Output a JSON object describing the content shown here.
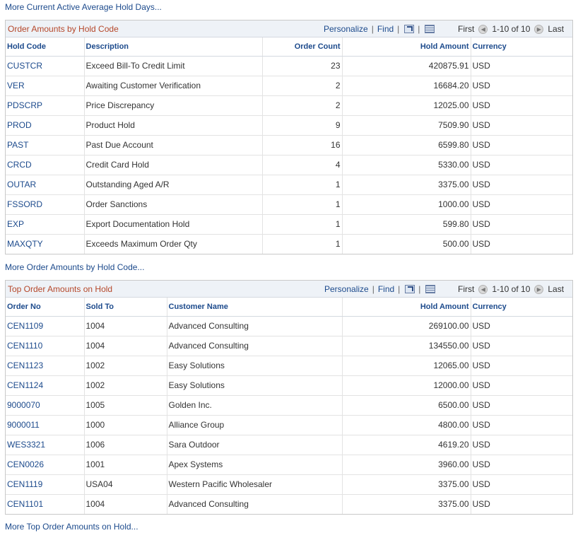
{
  "top_link": "More Current Active Average Hold Days...",
  "grid1": {
    "title": "Order Amounts by Hold Code",
    "personalize": "Personalize",
    "find": "Find",
    "separator": "|",
    "first": "First",
    "range": "1-10 of 10",
    "last": "Last",
    "headers": {
      "hold_code": "Hold Code",
      "description": "Description",
      "order_count": "Order Count",
      "hold_amount": "Hold Amount",
      "currency": "Currency"
    },
    "rows": [
      {
        "code": "CUSTCR",
        "description": "Exceed Bill-To Credit Limit",
        "count": "23",
        "amount": "420875.91",
        "currency": "USD"
      },
      {
        "code": "VER",
        "description": "Awaiting Customer Verification",
        "count": "2",
        "amount": "16684.20",
        "currency": "USD"
      },
      {
        "code": "PDSCRP",
        "description": "Price Discrepancy",
        "count": "2",
        "amount": "12025.00",
        "currency": "USD"
      },
      {
        "code": "PROD",
        "description": "Product Hold",
        "count": "9",
        "amount": "7509.90",
        "currency": "USD"
      },
      {
        "code": "PAST",
        "description": "Past Due Account",
        "count": "16",
        "amount": "6599.80",
        "currency": "USD"
      },
      {
        "code": "CRCD",
        "description": "Credit Card Hold",
        "count": "4",
        "amount": "5330.00",
        "currency": "USD"
      },
      {
        "code": "OUTAR",
        "description": "Outstanding Aged A/R",
        "count": "1",
        "amount": "3375.00",
        "currency": "USD"
      },
      {
        "code": "FSSORD",
        "description": "Order Sanctions",
        "count": "1",
        "amount": "1000.00",
        "currency": "USD"
      },
      {
        "code": "EXP",
        "description": "Export Documentation Hold",
        "count": "1",
        "amount": "599.80",
        "currency": "USD"
      },
      {
        "code": "MAXQTY",
        "description": "Exceeds Maximum Order Qty",
        "count": "1",
        "amount": "500.00",
        "currency": "USD"
      }
    ],
    "more_link": "More Order Amounts by Hold Code..."
  },
  "grid2": {
    "title": "Top Order Amounts on Hold",
    "personalize": "Personalize",
    "find": "Find",
    "separator": "|",
    "first": "First",
    "range": "1-10 of 10",
    "last": "Last",
    "headers": {
      "order_no": "Order No",
      "sold_to": "Sold To",
      "customer_name": "Customer Name",
      "hold_amount": "Hold Amount",
      "currency": "Currency"
    },
    "rows": [
      {
        "order": "CEN1109",
        "sold_to": "1004",
        "customer": "Advanced Consulting",
        "amount": "269100.00",
        "currency": "USD"
      },
      {
        "order": "CEN1110",
        "sold_to": "1004",
        "customer": "Advanced Consulting",
        "amount": "134550.00",
        "currency": "USD"
      },
      {
        "order": "CEN1123",
        "sold_to": "1002",
        "customer": "Easy Solutions",
        "amount": "12065.00",
        "currency": "USD"
      },
      {
        "order": "CEN1124",
        "sold_to": "1002",
        "customer": "Easy Solutions",
        "amount": "12000.00",
        "currency": "USD"
      },
      {
        "order": "9000070",
        "sold_to": "1005",
        "customer": "Golden Inc.",
        "amount": "6500.00",
        "currency": "USD"
      },
      {
        "order": "9000011",
        "sold_to": "1000",
        "customer": "Alliance Group",
        "amount": "4800.00",
        "currency": "USD"
      },
      {
        "order": "WES3321",
        "sold_to": "1006",
        "customer": "Sara Outdoor",
        "amount": "4619.20",
        "currency": "USD"
      },
      {
        "order": "CEN0026",
        "sold_to": "1001",
        "customer": "Apex Systems",
        "amount": "3960.00",
        "currency": "USD"
      },
      {
        "order": "CEN1119",
        "sold_to": "USA04",
        "customer": "Western Pacific Wholesaler",
        "amount": "3375.00",
        "currency": "USD"
      },
      {
        "order": "CEN1101",
        "sold_to": "1004",
        "customer": "Advanced Consulting",
        "amount": "3375.00",
        "currency": "USD"
      }
    ],
    "more_link": "More Top Order Amounts on Hold..."
  },
  "icons": {
    "zoom": "zoom-grid-icon",
    "download": "download-spreadsheet-icon",
    "prev": "previous-row-icon",
    "next": "next-row-icon"
  },
  "colors": {
    "link": "#1c4a8c",
    "title": "#b5472a",
    "header_bg": "#eef2f7"
  }
}
